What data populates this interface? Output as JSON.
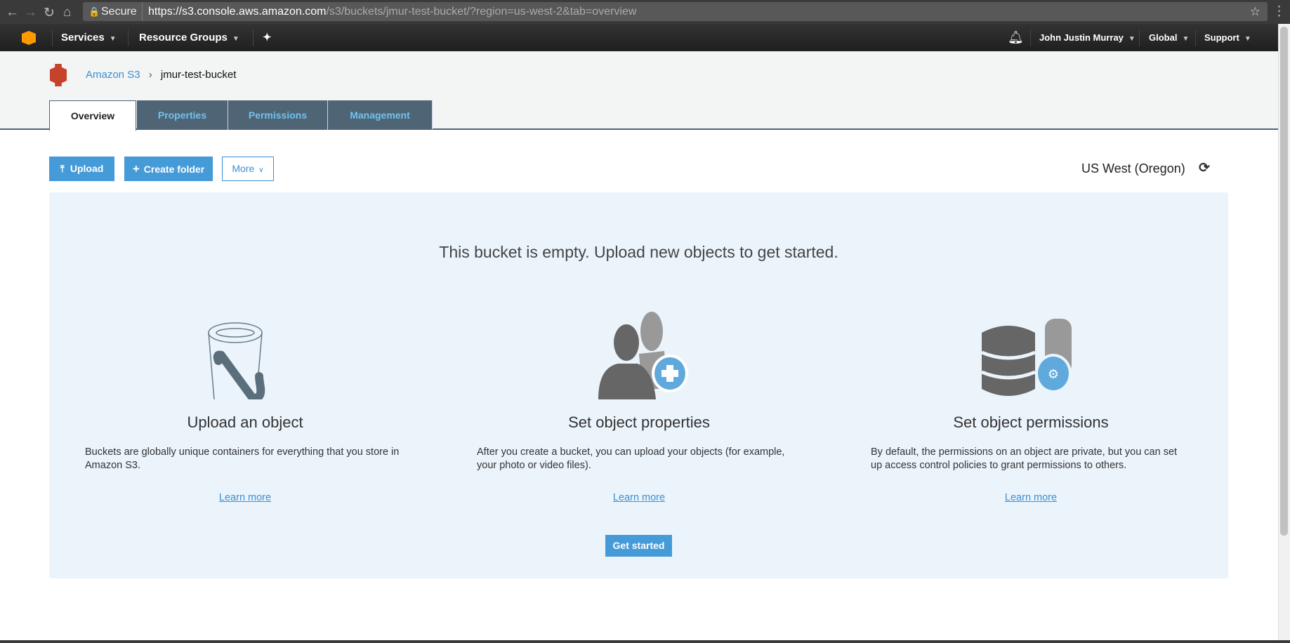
{
  "browser": {
    "secure_label": "Secure",
    "url_host": "https://s3.console.aws.amazon.com",
    "url_path": "/s3/buckets/jmur-test-bucket/?region=us-west-2&tab=overview"
  },
  "topnav": {
    "services": "Services",
    "resource_groups": "Resource Groups",
    "user": "John Justin Murray",
    "region": "Global",
    "support": "Support"
  },
  "breadcrumb": {
    "root": "Amazon S3",
    "separator": "›",
    "current": "jmur-test-bucket"
  },
  "tabs": [
    {
      "label": "Overview"
    },
    {
      "label": "Properties"
    },
    {
      "label": "Permissions"
    },
    {
      "label": "Management"
    }
  ],
  "toolbar": {
    "upload": "Upload",
    "create_folder": "Create folder",
    "more": "More",
    "region": "US West (Oregon)"
  },
  "empty": {
    "headline": "This bucket is empty. Upload new objects to get started.",
    "cards": [
      {
        "title": "Upload an object",
        "text": "Buckets are globally unique containers for everything that you store in Amazon S3.",
        "link": "Learn more"
      },
      {
        "title": "Set object properties",
        "text": "After you create a bucket, you can upload your objects (for example, your photo or video files).",
        "link": "Learn more"
      },
      {
        "title": "Set object permissions",
        "text": "By default, the permissions on an object are private, but you can set up access control policies to grant permissions to others.",
        "link": "Learn more"
      }
    ],
    "get_started": "Get started"
  },
  "colors": {
    "accent": "#459ad8",
    "tab_bg": "#4f6475",
    "panel_bg": "#ebf4fb"
  }
}
